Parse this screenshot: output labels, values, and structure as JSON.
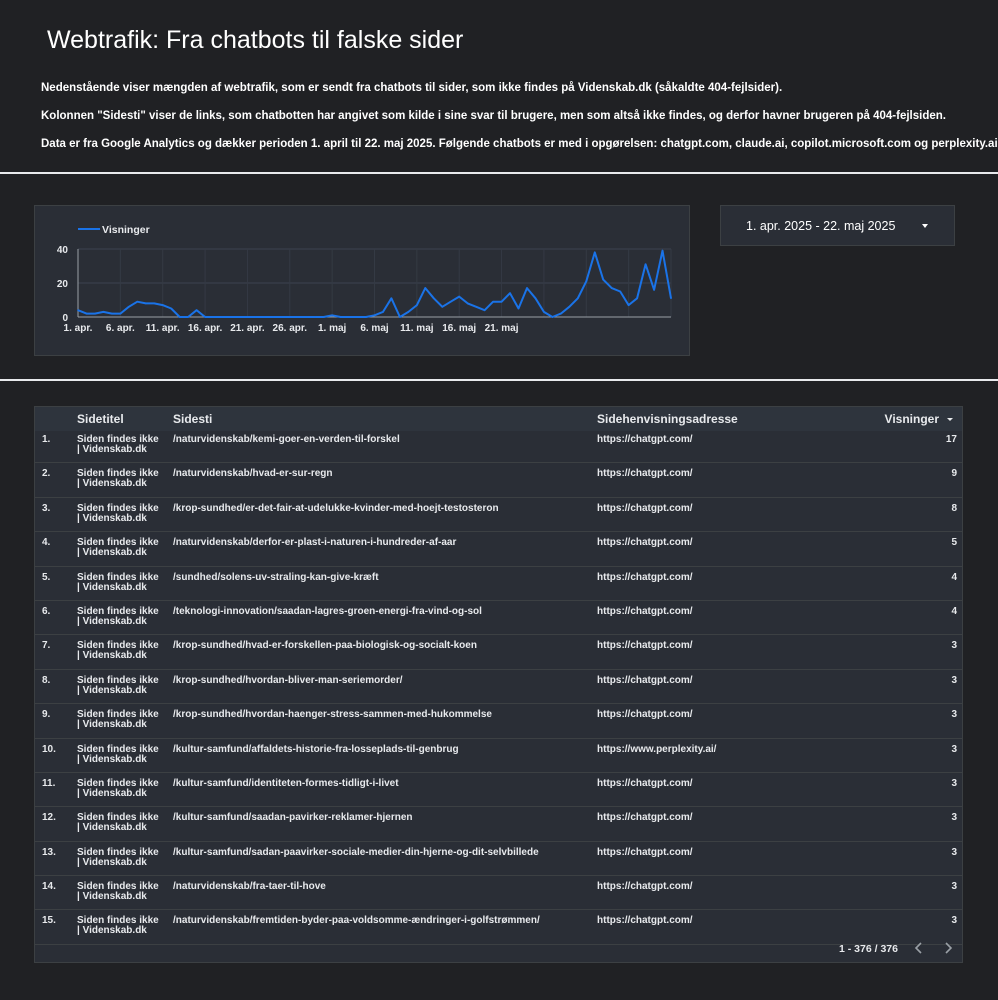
{
  "header": {
    "title": "Webtrafik: Fra chatbots til falske sider",
    "desc1": "Nedenstående viser mængden af webtrafik, som er sendt fra chatbots til sider, som ikke findes på Videnskab.dk (såkaldte 404-fejlsider).",
    "desc2": "Kolonnen \"Sidesti\" viser de links, som chatbotten har angivet som kilde i sine svar til brugere, men som altså ikke findes, og derfor havner brugeren på 404-fejlsiden.",
    "desc3": "Data er fra Google Analytics og dækker perioden 1. april til 22. maj 2025. Følgende chatbots er med i opgørelsen: chatgpt.com, claude.ai, copilot.microsoft.com og perplexity.ai"
  },
  "date_range": {
    "label": "1. apr. 2025 - 22. maj 2025"
  },
  "colors": {
    "line": "#1a73e8",
    "background": "#202124",
    "card": "#2a2e36"
  },
  "chart_data": {
    "type": "line",
    "series": [
      {
        "name": "Visninger",
        "values": [
          4,
          2,
          2,
          3,
          2,
          2,
          6,
          9,
          8,
          8,
          7,
          5,
          0,
          0,
          4,
          0,
          0,
          0,
          0,
          0,
          0,
          0,
          0,
          0,
          0,
          0,
          0,
          0,
          0,
          0,
          1,
          0,
          0,
          0,
          0,
          1,
          3,
          11,
          0,
          3,
          7,
          17,
          11,
          6,
          9,
          12,
          8,
          6,
          4,
          9,
          9,
          14,
          5,
          17,
          11,
          3,
          0,
          2,
          6,
          11,
          21,
          38,
          22,
          17,
          15,
          7,
          11,
          31,
          16,
          39,
          11
        ]
      }
    ],
    "x_start": "1. apr.",
    "x_ticks": [
      "1. apr.",
      "6. apr.",
      "11. apr.",
      "16. apr.",
      "21. apr.",
      "26. apr.",
      "1. maj",
      "6. maj",
      "11. maj",
      "16. maj",
      "21. maj"
    ],
    "y_ticks": [
      "0",
      "20",
      "40"
    ],
    "ylim": [
      0,
      40
    ],
    "legend_position": "top-left",
    "grid": true
  },
  "table": {
    "headers": {
      "sidetitel": "Sidetitel",
      "sidesti": "Sidesti",
      "ref": "Sidehenvisningsadresse",
      "visninger": "Visninger"
    },
    "rows": [
      {
        "num": "1.",
        "title1": "Siden findes ikke",
        "title2": "| Videnskab.dk",
        "path": "/naturvidenskab/kemi-goer-en-verden-til-forskel",
        "ref": "https://chatgpt.com/",
        "views": "17"
      },
      {
        "num": "2.",
        "title1": "Siden findes ikke",
        "title2": "| Videnskab.dk",
        "path": "/naturvidenskab/hvad-er-sur-regn",
        "ref": "https://chatgpt.com/",
        "views": "9"
      },
      {
        "num": "3.",
        "title1": "Siden findes ikke",
        "title2": "| Videnskab.dk",
        "path": "/krop-sundhed/er-det-fair-at-udelukke-kvinder-med-hoejt-testosteron",
        "ref": "https://chatgpt.com/",
        "views": "8"
      },
      {
        "num": "4.",
        "title1": "Siden findes ikke",
        "title2": "| Videnskab.dk",
        "path": "/naturvidenskab/derfor-er-plast-i-naturen-i-hundreder-af-aar",
        "ref": "https://chatgpt.com/",
        "views": "5"
      },
      {
        "num": "5.",
        "title1": "Siden findes ikke",
        "title2": "| Videnskab.dk",
        "path": "/sundhed/solens-uv-straling-kan-give-kræft",
        "ref": "https://chatgpt.com/",
        "views": "4"
      },
      {
        "num": "6.",
        "title1": "Siden findes ikke",
        "title2": "| Videnskab.dk",
        "path": "/teknologi-innovation/saadan-lagres-groen-energi-fra-vind-og-sol",
        "ref": "https://chatgpt.com/",
        "views": "4"
      },
      {
        "num": "7.",
        "title1": "Siden findes ikke",
        "title2": "| Videnskab.dk",
        "path": "/krop-sundhed/hvad-er-forskellen-paa-biologisk-og-socialt-koen",
        "ref": "https://chatgpt.com/",
        "views": "3"
      },
      {
        "num": "8.",
        "title1": "Siden findes ikke",
        "title2": "| Videnskab.dk",
        "path": "/krop-sundhed/hvordan-bliver-man-seriemorder/",
        "ref": "https://chatgpt.com/",
        "views": "3"
      },
      {
        "num": "9.",
        "title1": "Siden findes ikke",
        "title2": "| Videnskab.dk",
        "path": "/krop-sundhed/hvordan-haenger-stress-sammen-med-hukommelse",
        "ref": "https://chatgpt.com/",
        "views": "3"
      },
      {
        "num": "10.",
        "title1": "Siden findes ikke",
        "title2": "| Videnskab.dk",
        "path": "/kultur-samfund/affaldets-historie-fra-losseplads-til-genbrug",
        "ref": "https://www.perplexity.ai/",
        "views": "3"
      },
      {
        "num": "11.",
        "title1": "Siden findes ikke",
        "title2": "| Videnskab.dk",
        "path": "/kultur-samfund/identiteten-formes-tidligt-i-livet",
        "ref": "https://chatgpt.com/",
        "views": "3"
      },
      {
        "num": "12.",
        "title1": "Siden findes ikke",
        "title2": "| Videnskab.dk",
        "path": "/kultur-samfund/saadan-pavirker-reklamer-hjernen",
        "ref": "https://chatgpt.com/",
        "views": "3"
      },
      {
        "num": "13.",
        "title1": "Siden findes ikke",
        "title2": "| Videnskab.dk",
        "path": "/kultur-samfund/sadan-paavirker-sociale-medier-din-hjerne-og-dit-selvbillede",
        "ref": "https://chatgpt.com/",
        "views": "3"
      },
      {
        "num": "14.",
        "title1": "Siden findes ikke",
        "title2": "| Videnskab.dk",
        "path": "/naturvidenskab/fra-taer-til-hove",
        "ref": "https://chatgpt.com/",
        "views": "3"
      },
      {
        "num": "15.",
        "title1": "Siden findes ikke",
        "title2": "| Videnskab.dk",
        "path": "/naturvidenskab/fremtiden-byder-paa-voldsomme-ændringer-i-golfstrømmen/",
        "ref": "https://chatgpt.com/",
        "views": "3"
      }
    ],
    "pager": {
      "label": "1 - 376 / 376",
      "prev_icon": "chevron-left-icon",
      "next_icon": "chevron-right-icon"
    },
    "sort_icon": "caret-down-icon"
  }
}
